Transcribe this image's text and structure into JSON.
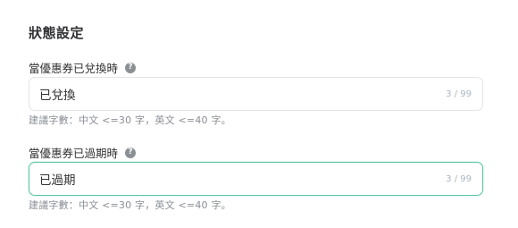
{
  "section": {
    "title": "狀態設定"
  },
  "redeemed": {
    "label": "當優惠券已兌換時",
    "help_icon_glyph": "?",
    "value": "已兌換",
    "counter": "3 / 99",
    "hint": "建議字數：中文 <=30 字，英文 <=40 字。"
  },
  "expired": {
    "label": "當優惠券已過期時",
    "help_icon_glyph": "?",
    "value": "已過期",
    "counter": "3 / 99",
    "hint": "建議字數：中文 <=30 字，英文 <=40 字。"
  },
  "colors": {
    "focus_border": "#5cc6a7",
    "default_border": "#e2e4e8",
    "help_icon_bg": "#8c9095",
    "counter_text": "#a9b6c2"
  }
}
